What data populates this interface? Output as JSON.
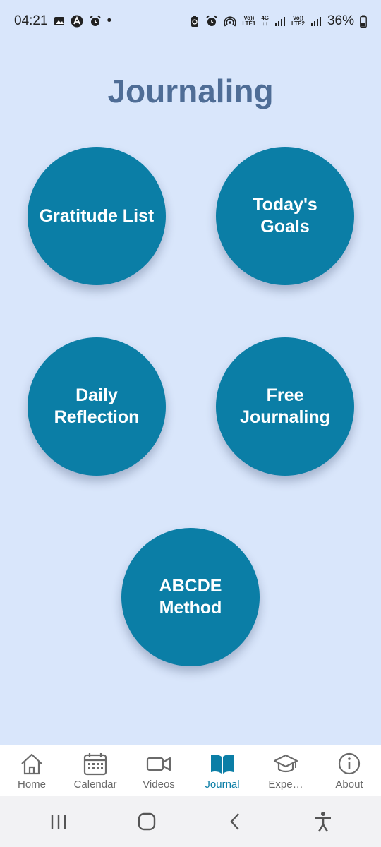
{
  "status_bar": {
    "time": "04:21",
    "dot": "•",
    "volte1": "Vo))",
    "lte1": "LTE1",
    "network": "4G",
    "volte2": "Vo))",
    "lte2": "LTE2",
    "battery": "36%"
  },
  "page": {
    "title": "Journaling"
  },
  "buttons": {
    "gratitude": "Gratitude List",
    "goals": "Today's Goals",
    "reflection": "Daily\nReflection",
    "free": "Free\nJournaling",
    "abcde": "ABCDE\nMethod"
  },
  "bottom_nav": {
    "items": [
      {
        "label": "Home",
        "icon": "home-icon"
      },
      {
        "label": "Calendar",
        "icon": "calendar-icon"
      },
      {
        "label": "Videos",
        "icon": "video-icon"
      },
      {
        "label": "Journal",
        "icon": "book-icon"
      },
      {
        "label": "Expe…",
        "icon": "graduation-cap-icon"
      },
      {
        "label": "About",
        "icon": "info-icon"
      }
    ],
    "active_index": 3
  },
  "colors": {
    "background": "#d9e6fb",
    "accent": "#0b7ea6",
    "title": "#4f6d96",
    "nav_inactive": "#6a6a6a"
  }
}
